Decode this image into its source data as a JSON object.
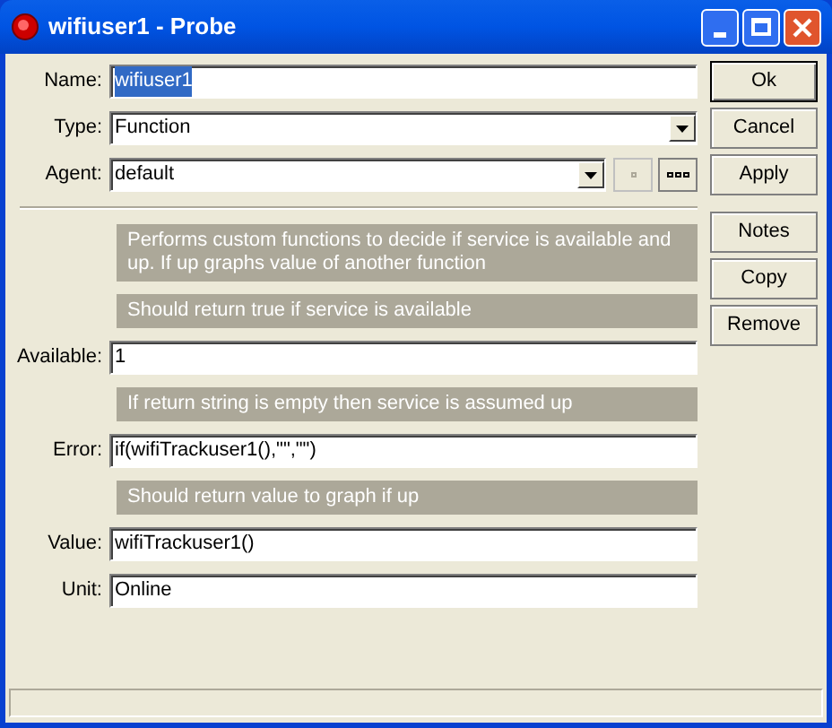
{
  "window": {
    "title": "wifiuser1 - Probe"
  },
  "header_fields": [
    {
      "kind": "text",
      "label": "Name:",
      "value": "wifiuser1",
      "highlighted": true
    },
    {
      "kind": "select",
      "label": "Type:",
      "value": "Function"
    },
    {
      "kind": "select_with_tools",
      "label": "Agent:",
      "value": "default"
    }
  ],
  "fields": [
    {
      "kind": "note",
      "text": "Performs custom functions to decide if service is available and up. If up graphs value of another function"
    },
    {
      "kind": "note",
      "text": "Should return true if service is available"
    },
    {
      "kind": "text",
      "label": "Available:",
      "value": "1",
      "highlighted": false
    },
    {
      "kind": "note",
      "text": "If return string is empty then service is assumed up"
    },
    {
      "kind": "text",
      "label": "Error:",
      "value": "if(wifiTrackuser1(),\"\",\"\")",
      "highlighted": false
    },
    {
      "kind": "note",
      "text": "Should return value to graph if up"
    },
    {
      "kind": "text",
      "label": "Value:",
      "value": "wifiTrackuser1()",
      "highlighted": false
    },
    {
      "kind": "text",
      "label": "Unit:",
      "value": "Online",
      "highlighted": false
    }
  ],
  "dialog_buttons": [
    {
      "label": "Ok",
      "default": true
    },
    {
      "label": "Cancel",
      "default": false
    },
    {
      "label": "Apply",
      "default": false
    }
  ],
  "action_buttons": [
    {
      "label": "Notes",
      "default": false
    },
    {
      "label": "Copy",
      "default": false
    },
    {
      "label": "Remove",
      "default": false
    }
  ]
}
